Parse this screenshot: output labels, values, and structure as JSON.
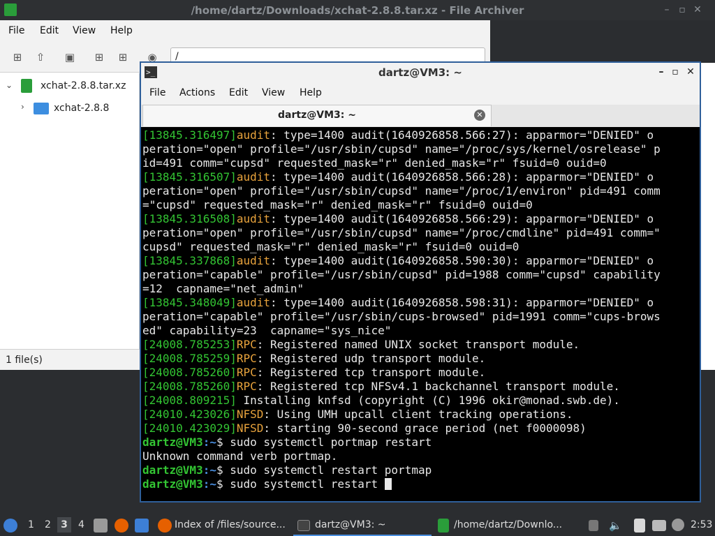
{
  "archiver": {
    "title": "/home/dartz/Downloads/xchat-2.8.8.tar.xz - File Archiver",
    "menu": [
      "File",
      "Edit",
      "View",
      "Help"
    ],
    "location": "/",
    "tree": [
      {
        "label": "xchat-2.8.8.tar.xz",
        "icon": "archive-icon"
      },
      {
        "label": "xchat-2.8.8",
        "icon": "folder-icon"
      }
    ],
    "status": "1 file(s)",
    "window_controls": [
      "–",
      "▫",
      "✕"
    ]
  },
  "terminal": {
    "title": "dartz@VM3: ~",
    "menu": [
      "File",
      "Actions",
      "Edit",
      "View",
      "Help"
    ],
    "tab_label": "dartz@VM3: ~",
    "window_controls": [
      "–",
      "▫",
      "✕"
    ],
    "lines": [
      {
        "ts": "[13845.316497]",
        "src": "audit",
        "text": ": type=1400 audit(1640926858.566:27): apparmor=\"DENIED\" o"
      },
      {
        "text": "peration=\"open\" profile=\"/usr/sbin/cupsd\" name=\"/proc/sys/kernel/osrelease\" p"
      },
      {
        "text": "id=491 comm=\"cupsd\" requested_mask=\"r\" denied_mask=\"r\" fsuid=0 ouid=0"
      },
      {
        "ts": "[13845.316507]",
        "src": "audit",
        "text": ": type=1400 audit(1640926858.566:28): apparmor=\"DENIED\" o"
      },
      {
        "text": "peration=\"open\" profile=\"/usr/sbin/cupsd\" name=\"/proc/1/environ\" pid=491 comm"
      },
      {
        "text": "=\"cupsd\" requested_mask=\"r\" denied_mask=\"r\" fsuid=0 ouid=0"
      },
      {
        "ts": "[13845.316508]",
        "src": "audit",
        "text": ": type=1400 audit(1640926858.566:29): apparmor=\"DENIED\" o"
      },
      {
        "text": "peration=\"open\" profile=\"/usr/sbin/cupsd\" name=\"/proc/cmdline\" pid=491 comm=\""
      },
      {
        "text": "cupsd\" requested_mask=\"r\" denied_mask=\"r\" fsuid=0 ouid=0"
      },
      {
        "ts": "[13845.337868]",
        "src": "audit",
        "text": ": type=1400 audit(1640926858.590:30): apparmor=\"DENIED\" o"
      },
      {
        "text": "peration=\"capable\" profile=\"/usr/sbin/cupsd\" pid=1988 comm=\"cupsd\" capability"
      },
      {
        "text": "=12  capname=\"net_admin\""
      },
      {
        "ts": "[13845.348049]",
        "src": "audit",
        "text": ": type=1400 audit(1640926858.598:31): apparmor=\"DENIED\" o"
      },
      {
        "text": "peration=\"capable\" profile=\"/usr/sbin/cups-browsed\" pid=1991 comm=\"cups-brows"
      },
      {
        "text": "ed\" capability=23  capname=\"sys_nice\""
      },
      {
        "ts": "[24008.785253]",
        "src": "RPC",
        "text": ": Registered named UNIX socket transport module."
      },
      {
        "ts": "[24008.785259]",
        "src": "RPC",
        "text": ": Registered udp transport module."
      },
      {
        "ts": "[24008.785260]",
        "src": "RPC",
        "text": ": Registered tcp transport module."
      },
      {
        "ts": "[24008.785260]",
        "src": "RPC",
        "text": ": Registered tcp NFSv4.1 backchannel transport module."
      },
      {
        "ts": "[24008.809215]",
        "text": " Installing knfsd (copyright (C) 1996 okir@monad.swb.de)."
      },
      {
        "ts": "[24010.423026]",
        "src": "NFSD",
        "text": ": Using UMH upcall client tracking operations."
      },
      {
        "ts": "[24010.423029]",
        "src": "NFSD",
        "text": ": starting 90-second grace period (net f0000098)"
      },
      {
        "prompt_user": "dartz@VM3",
        "prompt_path": ":~",
        "text": "$ sudo systemctl portmap restart"
      },
      {
        "text": "Unknown command verb portmap."
      },
      {
        "prompt_user": "dartz@VM3",
        "prompt_path": ":~",
        "text": "$ sudo systemctl restart portmap"
      },
      {
        "prompt_user": "dartz@VM3",
        "prompt_path": ":~",
        "text": "$ sudo systemctl restart ",
        "cursor": true
      }
    ]
  },
  "taskbar": {
    "workspaces": [
      "1",
      "2",
      "3",
      "4"
    ],
    "active_workspace": "3",
    "tasks": [
      {
        "label": "Index of /files/source...",
        "icon": "firefox-icon"
      },
      {
        "label": "dartz@VM3: ~",
        "icon": "terminal-icon"
      },
      {
        "label": "/home/dartz/Downlo...",
        "icon": "archive-icon"
      }
    ],
    "clock": "2:53"
  },
  "colors": {
    "accent": "#2f5f9a",
    "term_green": "#33c533",
    "term_orange": "#e8a33c",
    "prompt_blue": "#4a8fe0"
  }
}
